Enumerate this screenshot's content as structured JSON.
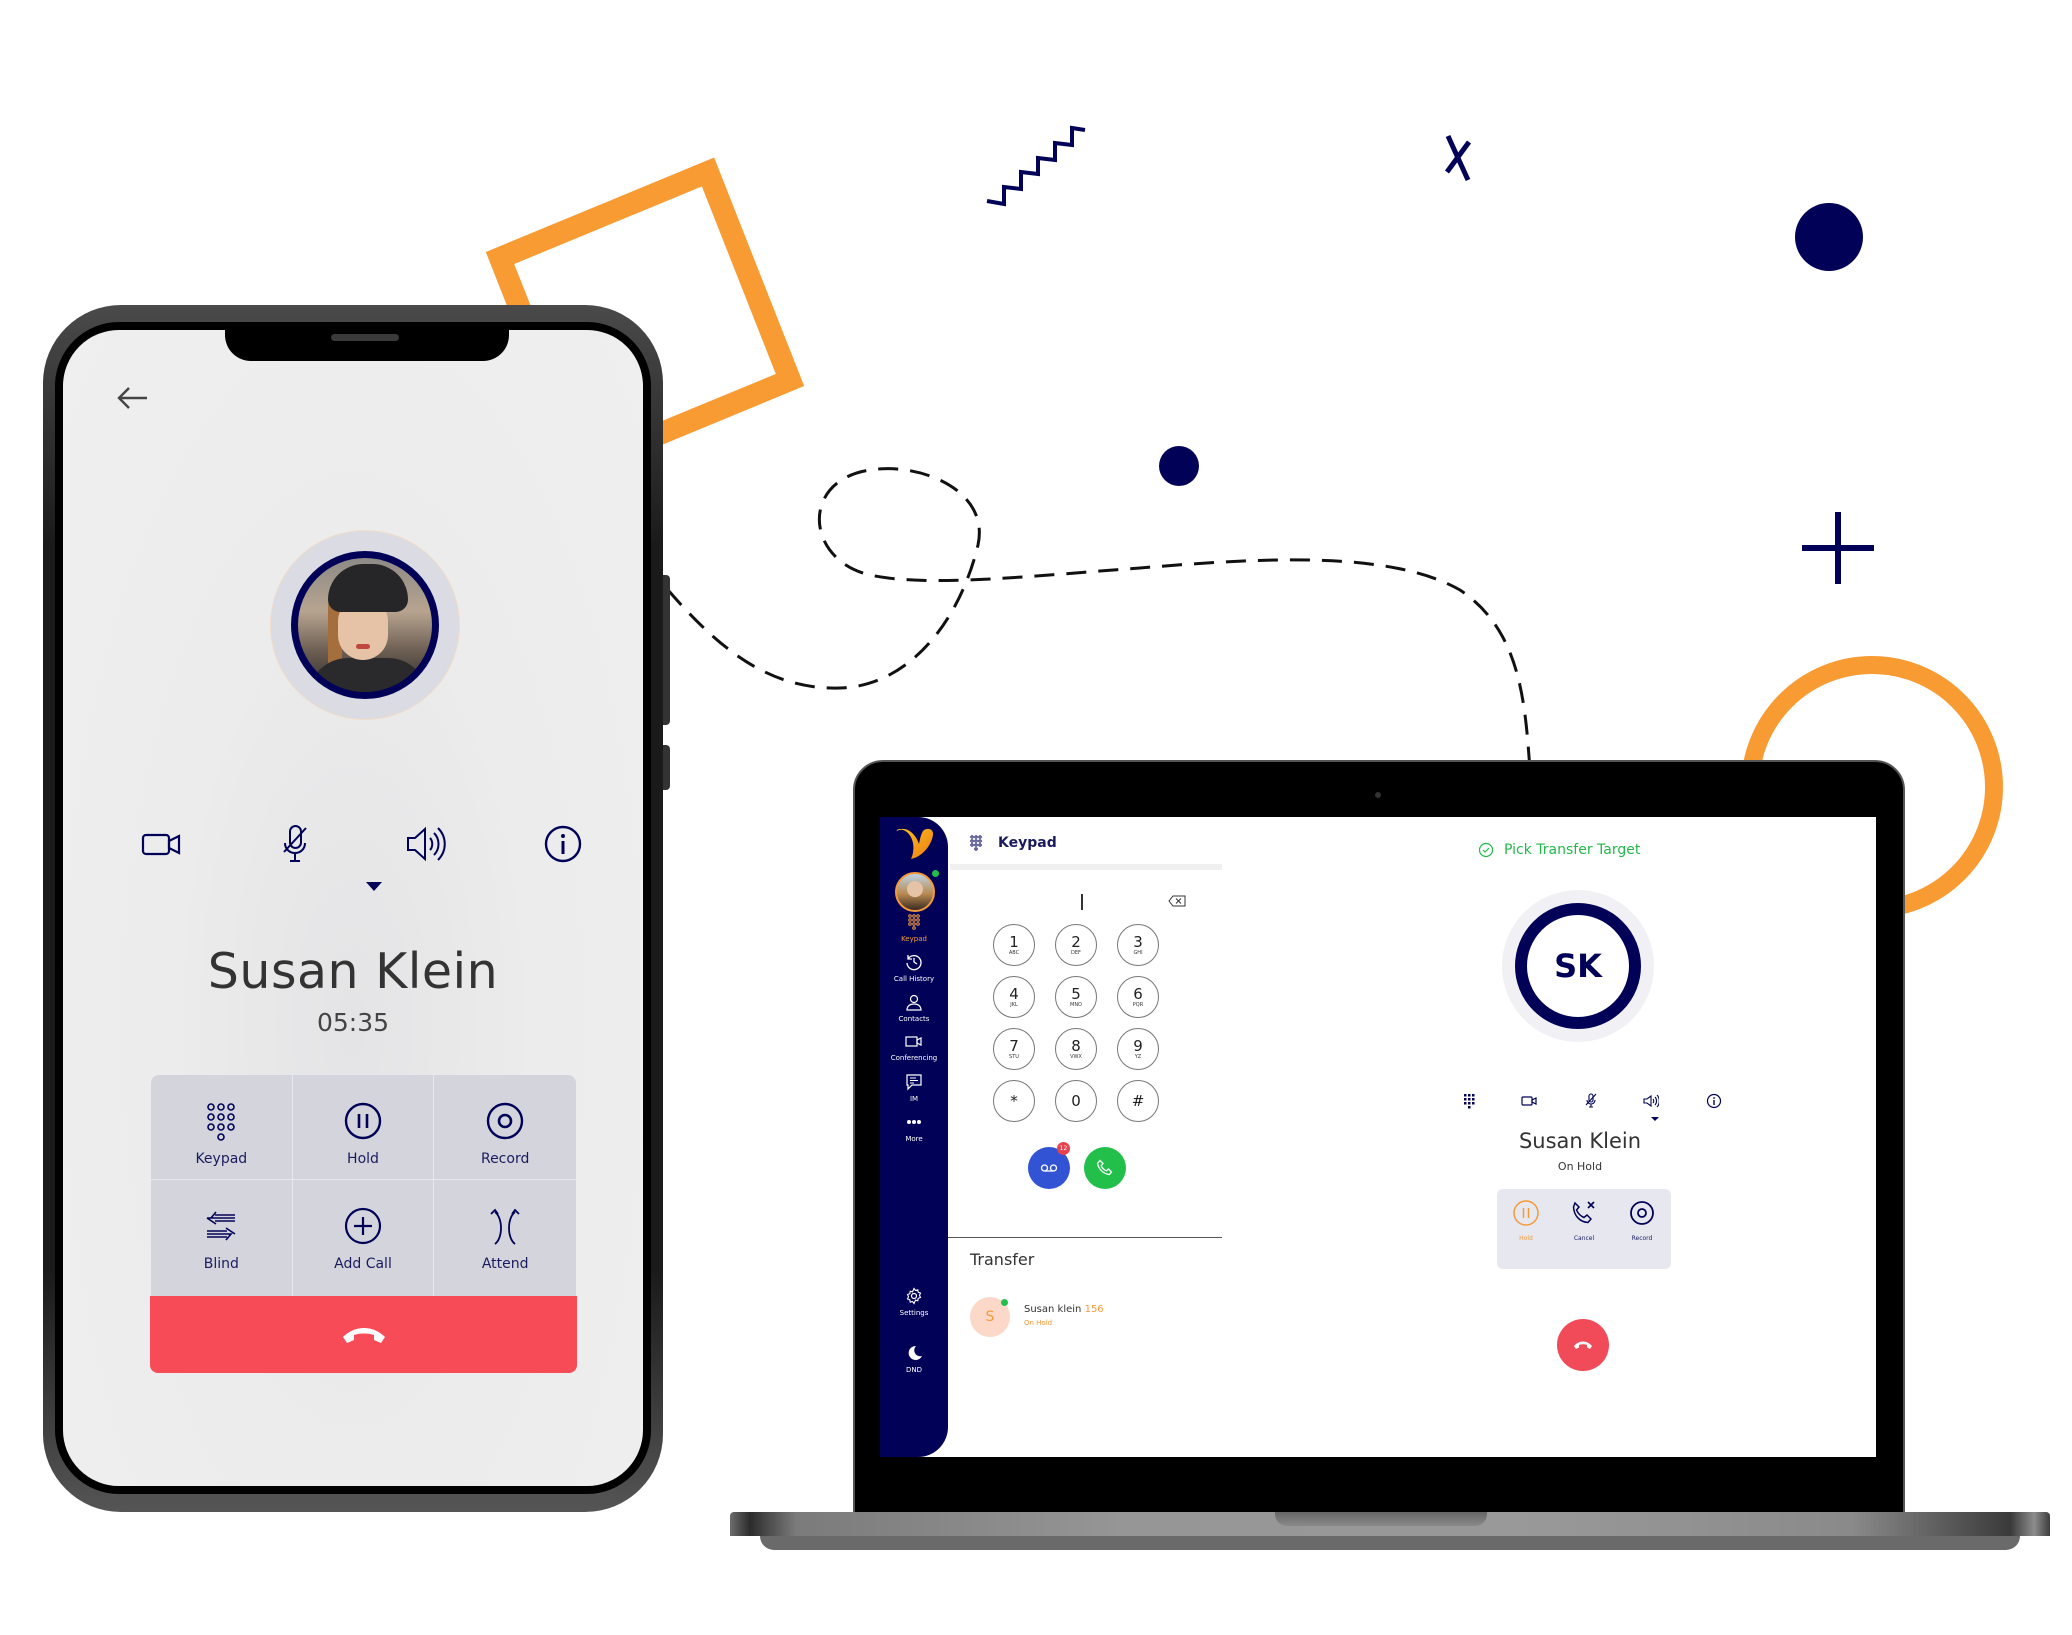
{
  "colors": {
    "navy": "#010257",
    "orange": "#f99b33",
    "end_call_red": "#f74b58",
    "call_green": "#22c04a",
    "voicemail_blue": "#3153d4",
    "status_green": "#22b84a"
  },
  "phone": {
    "back_icon": "arrow-left-icon",
    "controls": [
      {
        "name": "video",
        "icon": "video-camera-icon"
      },
      {
        "name": "mute",
        "icon": "microphone-off-icon"
      },
      {
        "name": "speaker",
        "icon": "speaker-icon"
      },
      {
        "name": "info",
        "icon": "info-icon"
      }
    ],
    "caller_name": "Susan Klein",
    "call_timer": "05:35",
    "actions": [
      {
        "label": "Keypad",
        "icon": "dialpad-icon"
      },
      {
        "label": "Hold",
        "icon": "pause-circle-icon"
      },
      {
        "label": "Record",
        "icon": "record-icon"
      },
      {
        "label": "Blind",
        "icon": "blind-transfer-icon"
      },
      {
        "label": "Add Call",
        "icon": "add-circle-icon"
      },
      {
        "label": "Attend",
        "icon": "attended-transfer-icon"
      }
    ],
    "end_call_icon": "hang-up-icon"
  },
  "laptop": {
    "sidebar": {
      "logo": "brand-logo",
      "items": [
        {
          "label": "Keypad",
          "icon": "dialpad-icon",
          "active": true
        },
        {
          "label": "Call History",
          "icon": "history-icon"
        },
        {
          "label": "Contacts",
          "icon": "contact-icon"
        },
        {
          "label": "Conferencing",
          "icon": "video-camera-icon"
        },
        {
          "label": "IM",
          "icon": "chat-icon"
        },
        {
          "label": "More",
          "icon": "more-dots-icon"
        },
        {
          "label": "Settings",
          "icon": "gear-icon"
        },
        {
          "label": "DND",
          "icon": "moon-icon"
        }
      ]
    },
    "keypad": {
      "title": "Keypad",
      "input_value": "",
      "keys": [
        {
          "digit": "1",
          "letters": "ABC"
        },
        {
          "digit": "2",
          "letters": "DEF"
        },
        {
          "digit": "3",
          "letters": "GHI"
        },
        {
          "digit": "4",
          "letters": "JKL"
        },
        {
          "digit": "5",
          "letters": "MNO"
        },
        {
          "digit": "6",
          "letters": "PQR"
        },
        {
          "digit": "7",
          "letters": "STU"
        },
        {
          "digit": "8",
          "letters": "VWX"
        },
        {
          "digit": "9",
          "letters": "YZ"
        },
        {
          "digit": "*",
          "letters": ""
        },
        {
          "digit": "0",
          "letters": ""
        },
        {
          "digit": "#",
          "letters": ""
        }
      ],
      "voicemail_count": "12"
    },
    "transfer": {
      "title": "Transfer",
      "items": [
        {
          "initial": "S",
          "name": "Susan klein",
          "extension": "156",
          "status": "On Hold"
        }
      ]
    },
    "call_panel": {
      "banner": "Pick Transfer Target",
      "initials": "SK",
      "controls": [
        {
          "name": "keypad",
          "icon": "dialpad-icon"
        },
        {
          "name": "video",
          "icon": "video-camera-icon"
        },
        {
          "name": "mute",
          "icon": "microphone-off-icon"
        },
        {
          "name": "speaker",
          "icon": "speaker-icon"
        },
        {
          "name": "info",
          "icon": "info-icon"
        }
      ],
      "caller_name": "Susan Klein",
      "status": "On Hold",
      "actions": [
        {
          "label": "Hold",
          "icon": "pause-circle-icon",
          "active": true
        },
        {
          "label": "Cancel",
          "icon": "call-cancel-icon"
        },
        {
          "label": "Record",
          "icon": "record-icon"
        }
      ]
    }
  }
}
